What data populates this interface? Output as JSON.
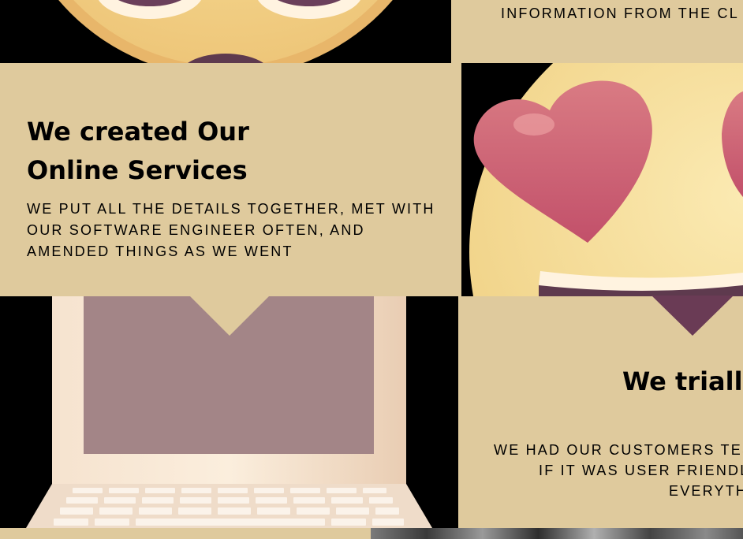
{
  "top_right_panel": {
    "caption": "INFORMATION FROM THE CL"
  },
  "services_panel": {
    "title_line1": "We created Our",
    "title_line2": "Online Services",
    "body": "WE PUT ALL THE DETAILS TOGETHER, MET WITH OUR SOFTWARE ENGINEER OFTEN, AND AMENDED THINGS AS WE WENT"
  },
  "trial_panel": {
    "title": "We trialle",
    "body_line1": "WE HAD OUR CUSTOMERS TES",
    "body_line2": "IF IT WAS USER FRIENDLY",
    "body_line3": "EVERYTH"
  },
  "images": {
    "top_left": "surprised-emoji",
    "middle_right": "heart-eyes-emoji",
    "bottom_left": "laptop-illustration",
    "bottom_strip": "photo-strip"
  },
  "colors": {
    "panel_bg": "#dfca9d",
    "background": "#000000",
    "heart": "#d16477",
    "emoji_face": "#f6dc8c"
  }
}
